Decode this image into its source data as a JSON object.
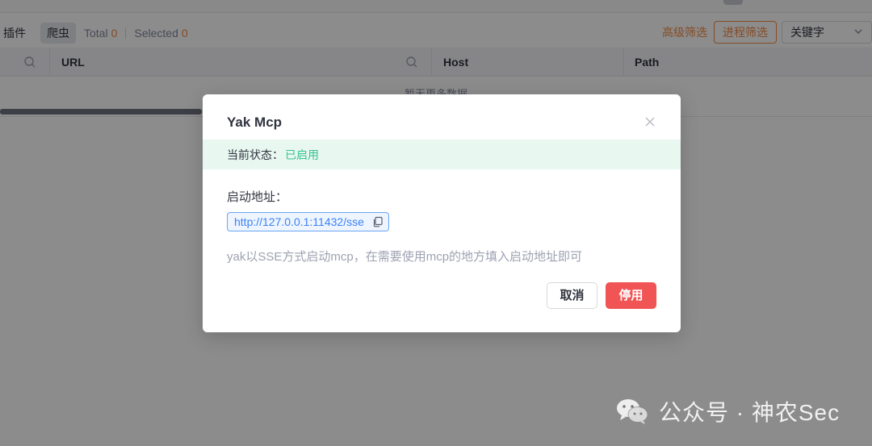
{
  "toolbar": {
    "plugin_label": "插件",
    "crawler_label": "爬虫",
    "total_label": "Total",
    "total_value": "0",
    "selected_label": "Selected",
    "selected_value": "0",
    "advanced_filter_label": "高级筛选",
    "process_filter_label": "进程筛选",
    "keyword_select_value": "关键字"
  },
  "table": {
    "columns": [
      "URL",
      "Host",
      "Path"
    ],
    "empty_text": "暂无更多数据"
  },
  "modal": {
    "title": "Yak Mcp",
    "status_label": "当前状态：",
    "status_value": "已启用",
    "address_label": "启动地址：",
    "address_value": "http://127.0.0.1:11432/sse",
    "hint": "yak以SSE方式启动mcp，在需要使用mcp的地方填入启动地址即可",
    "cancel_label": "取消",
    "disable_label": "停用"
  },
  "watermark": {
    "text": "公众号 · 神农Sec",
    "icon": "wechat-icon"
  },
  "colors": {
    "accent_orange": "#f28b44",
    "status_green": "#33c48d",
    "link_blue": "#3b82f6",
    "danger_red": "#f05454"
  }
}
